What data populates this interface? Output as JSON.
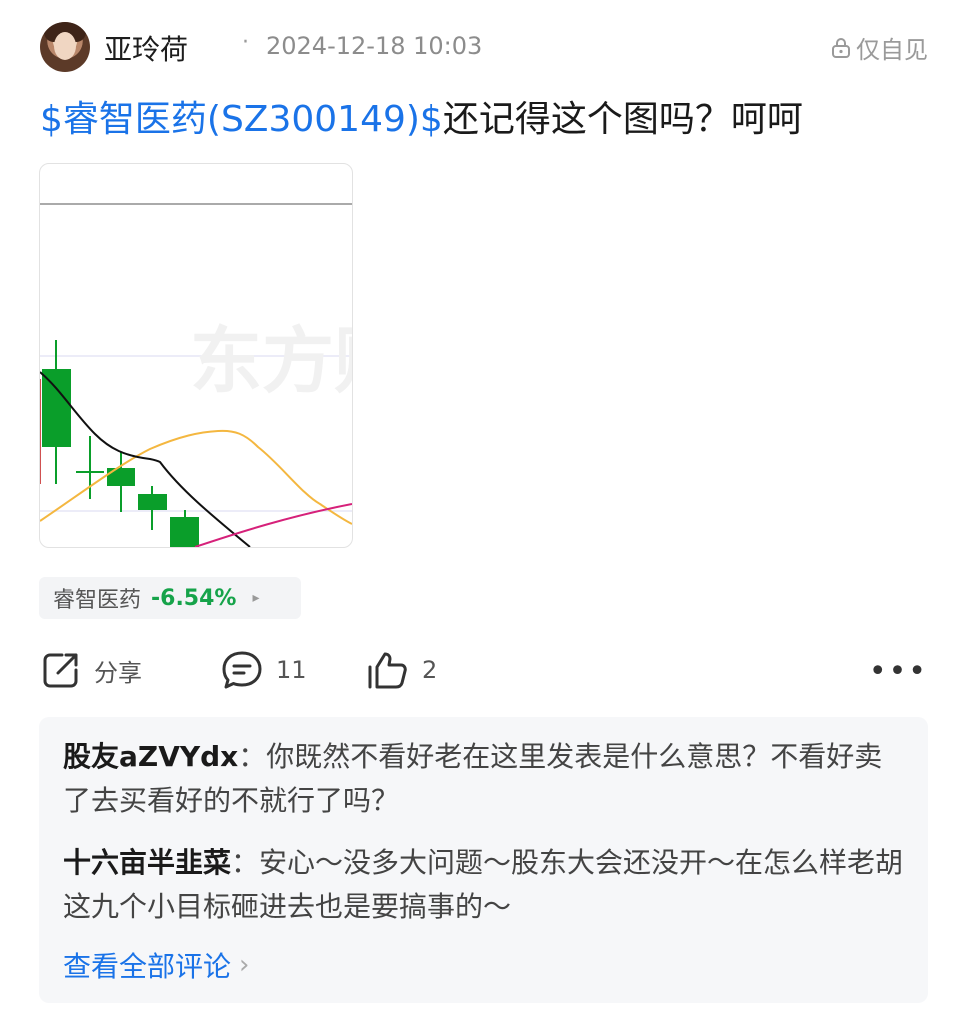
{
  "post": {
    "author": "亚玲荷",
    "separator": "·",
    "timestamp": "2024-12-18 10:03",
    "visibility": "仅自见",
    "stock_link": "$睿智医药(SZ300149)$",
    "text": "还记得这个图吗？呵呵",
    "chart_watermark": "东方财"
  },
  "quote": {
    "name": "睿智医药",
    "change": "-6.54%",
    "arrow": "▸",
    "change_color": "#16a34a"
  },
  "actions": {
    "share_label": "分享",
    "comment_count": "11",
    "like_count": "2",
    "more_label": "•••"
  },
  "comments": [
    {
      "author": "股友aZVYdx",
      "colon": "：",
      "text": "你既然不看好老在这里发表是什么意思？不看好卖了去买看好的不就行了吗？"
    },
    {
      "author": "十六亩半韭菜",
      "colon": "：",
      "text": "安心～没多大问题～股东大会还没开～在怎么样老胡这九个小目标砸进去也是要搞事的～"
    }
  ],
  "view_all": {
    "label": "查看全部评论",
    "chevron": "›"
  },
  "colors": {
    "link_blue": "#1a73e8",
    "candle_green": "#0a9e2a",
    "ma_orange": "#f4b740",
    "ma_black": "#111111",
    "ma_pink": "#d6217a"
  }
}
